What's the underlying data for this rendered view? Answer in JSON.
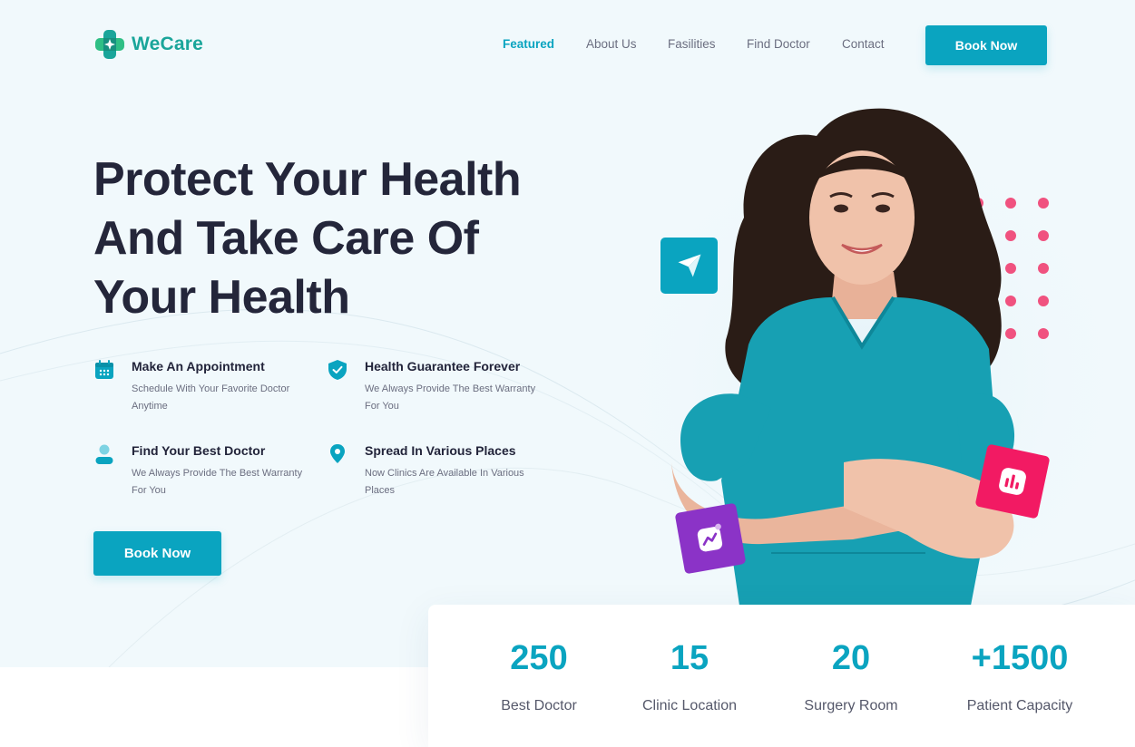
{
  "brand": {
    "name": "WeCare",
    "logo_icon": "medical-cross-icon",
    "logo_color": "#1aa59a"
  },
  "nav": {
    "items": [
      {
        "label": "Featured",
        "active": true
      },
      {
        "label": "About Us",
        "active": false
      },
      {
        "label": "Fasilities",
        "active": false
      },
      {
        "label": "Find Doctor",
        "active": false
      },
      {
        "label": "Contact",
        "active": false
      }
    ],
    "cta_label": "Book Now"
  },
  "hero": {
    "headline": [
      "Protect Your Health",
      "And Take Care Of",
      "Your Health"
    ],
    "features": [
      {
        "icon": "calendar-icon",
        "title": "Make An Appointment",
        "desc": "Schedule With Your Favorite Doctor Anytime"
      },
      {
        "icon": "shield-check-icon",
        "title": "Health Guarantee Forever",
        "desc": "We Always Provide The Best Warranty For You"
      },
      {
        "icon": "user-icon",
        "title": "Find Your Best Doctor",
        "desc": "We Always Provide The Best Warranty For You"
      },
      {
        "icon": "location-pin-icon",
        "title": "Spread In Various Places",
        "desc": "Now Clinics Are Available In Various Places"
      }
    ],
    "cta_label": "Book Now"
  },
  "floating_icons": [
    "paper-plane-icon",
    "bar-chart-icon",
    "trend-chart-icon"
  ],
  "stats": [
    {
      "value": "250",
      "label": "Best Doctor"
    },
    {
      "value": "15",
      "label": "Clinic Location"
    },
    {
      "value": "20",
      "label": "Surgery Room"
    },
    {
      "value": "+1500",
      "label": "Patient Capacity"
    }
  ],
  "colors": {
    "primary": "#0aa4c0",
    "heading": "#24263a",
    "text": "#6b6e80",
    "hero_bg": "#f1f9fc",
    "accent_pink": "#f0527f",
    "accent_purple": "#8b33c7"
  }
}
